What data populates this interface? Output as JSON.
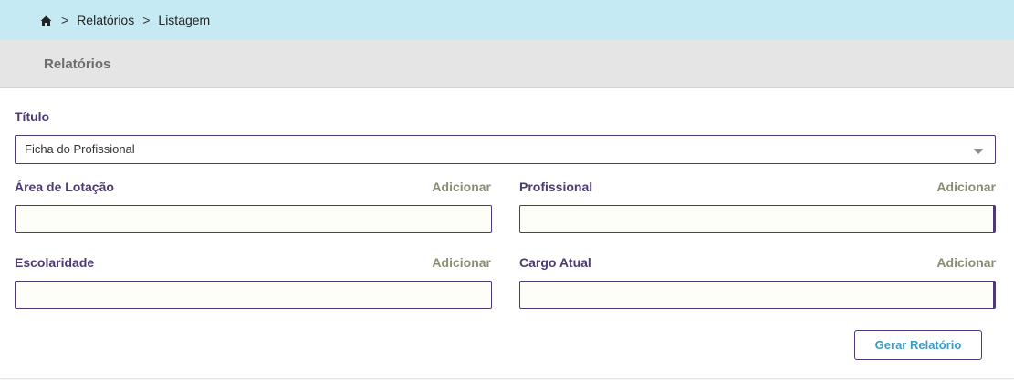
{
  "breadcrumb": {
    "home_icon": "home-icon",
    "separator": ">",
    "items": [
      "Relatórios",
      "Listagem"
    ]
  },
  "header": {
    "title": "Relatórios"
  },
  "form": {
    "titulo": {
      "label": "Título",
      "selected": "Ficha do Profissional"
    },
    "area_lotacao": {
      "label": "Área de Lotação",
      "add": "Adicionar",
      "value": ""
    },
    "profissional": {
      "label": "Profissional",
      "add": "Adicionar",
      "value": ""
    },
    "escolaridade": {
      "label": "Escolaridade",
      "add": "Adicionar",
      "value": ""
    },
    "cargo_atual": {
      "label": "Cargo Atual",
      "add": "Adicionar",
      "value": ""
    },
    "submit_label": "Gerar Relatório"
  },
  "colors": {
    "breadcrumb_bg": "#c5eaf3",
    "header_bg": "#e5e5e5",
    "label": "#4e3a72",
    "add_link": "#8c8c72",
    "button_text": "#3a9ec4"
  }
}
